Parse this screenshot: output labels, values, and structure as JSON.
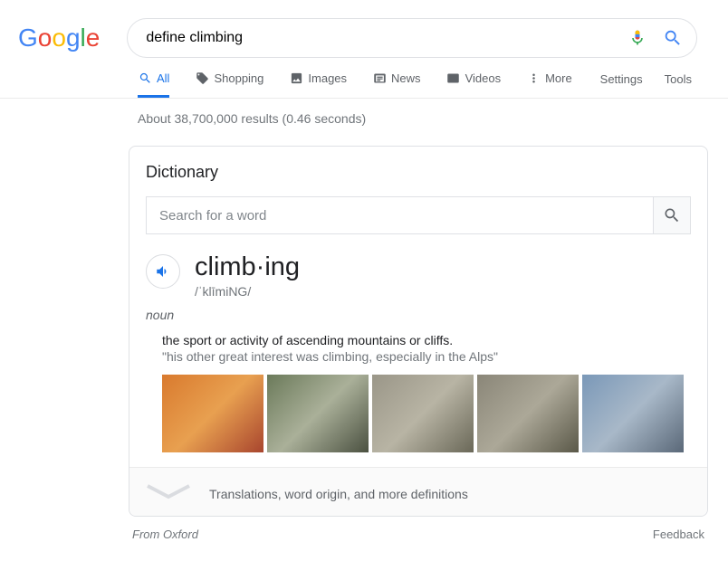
{
  "logo": {
    "letters": [
      {
        "char": "G",
        "color": "#4285F4"
      },
      {
        "char": "o",
        "color": "#EA4335"
      },
      {
        "char": "o",
        "color": "#FBBC05"
      },
      {
        "char": "g",
        "color": "#4285F4"
      },
      {
        "char": "l",
        "color": "#34A853"
      },
      {
        "char": "e",
        "color": "#EA4335"
      }
    ]
  },
  "search": {
    "value": "define climbing"
  },
  "tabs": {
    "all": "All",
    "shopping": "Shopping",
    "images": "Images",
    "news": "News",
    "videos": "Videos",
    "more": "More"
  },
  "tools": {
    "settings": "Settings",
    "tools": "Tools"
  },
  "stats": "About 38,700,000 results (0.46 seconds)",
  "dictionary": {
    "title": "Dictionary",
    "search_placeholder": "Search for a word",
    "word": "climb·ing",
    "pronunciation": "/ˈklīmiNG/",
    "pos": "noun",
    "definition": "the sport or activity of ascending mountains or cliffs.",
    "example": "\"his other great interest was climbing, especially in the Alps\"",
    "more": "Translations, word origin, and more definitions"
  },
  "footer": {
    "source": "From Oxford",
    "feedback": "Feedback"
  }
}
